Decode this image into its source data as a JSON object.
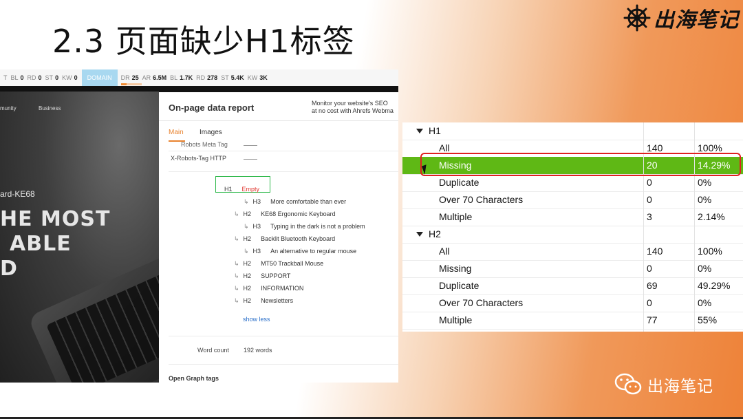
{
  "slide": {
    "title": "2.3 页面缺少H1标签",
    "brand": "出海笔记",
    "wechat_name": "出海笔记"
  },
  "seo_bar": {
    "metrics_left": [
      {
        "label": "T",
        "value": ""
      },
      {
        "label": "BL",
        "value": "0"
      },
      {
        "label": "RD",
        "value": "0"
      },
      {
        "label": "ST",
        "value": "0"
      },
      {
        "label": "KW",
        "value": "0"
      }
    ],
    "domain_label": "DOMAIN",
    "metrics_right": [
      {
        "label": "DR",
        "value": "25"
      },
      {
        "label": "AR",
        "value": "6.5M"
      },
      {
        "label": "BL",
        "value": "1.7K"
      },
      {
        "label": "RD",
        "value": "278"
      },
      {
        "label": "ST",
        "value": "5.4K"
      },
      {
        "label": "KW",
        "value": "3K"
      }
    ]
  },
  "hero": {
    "nav": [
      "munity",
      "Business"
    ],
    "product": "ard-KE68",
    "headline": [
      "HE MOST",
      "ABLE",
      "D"
    ]
  },
  "report": {
    "title": "On-page data report",
    "monitor_line1": "Monitor your website's SEO",
    "monitor_line2": "at no cost with Ahrefs Webma",
    "tabs": [
      "Main",
      "Images"
    ],
    "robots_meta": "Robots Meta Tag",
    "x_robots": "X-Robots-Tag HTTP",
    "h1_label": "H1",
    "h1_value": "Empty",
    "headings": [
      {
        "level": "H3",
        "text": "More comfortable than ever"
      },
      {
        "level": "H2",
        "text": "KE68 Ergonomic Keyboard"
      },
      {
        "level": "H3",
        "text": "Typing in the dark is not a problem"
      },
      {
        "level": "H2",
        "text": "Backlit Bluetooth Keyboard"
      },
      {
        "level": "H3",
        "text": "An alternative to regular mouse"
      },
      {
        "level": "H2",
        "text": "MT50 Trackball Mouse"
      },
      {
        "level": "H2",
        "text": "SUPPORT"
      },
      {
        "level": "H2",
        "text": "INFORMATION"
      },
      {
        "level": "H2",
        "text": "Newsletters"
      }
    ],
    "show_less": "show less",
    "word_count_label": "Word count",
    "word_count_value": "192 words",
    "open_graph": "Open Graph tags"
  },
  "issues_table": {
    "groups": [
      {
        "name": "H1",
        "rows": [
          {
            "label": "All",
            "count": "140",
            "pct": "100%"
          },
          {
            "label": "Missing",
            "count": "20",
            "pct": "14.29%",
            "highlighted": true
          },
          {
            "label": "Duplicate",
            "count": "0",
            "pct": "0%"
          },
          {
            "label": "Over 70 Characters",
            "count": "0",
            "pct": "0%"
          },
          {
            "label": "Multiple",
            "count": "3",
            "pct": "2.14%"
          }
        ]
      },
      {
        "name": "H2",
        "rows": [
          {
            "label": "All",
            "count": "140",
            "pct": "100%"
          },
          {
            "label": "Missing",
            "count": "0",
            "pct": "0%"
          },
          {
            "label": "Duplicate",
            "count": "69",
            "pct": "49.29%"
          },
          {
            "label": "Over 70 Characters",
            "count": "0",
            "pct": "0%"
          },
          {
            "label": "Multiple",
            "count": "77",
            "pct": "55%"
          }
        ]
      }
    ],
    "highlight_color": "#5fb815",
    "callout_color": "#e02020"
  }
}
